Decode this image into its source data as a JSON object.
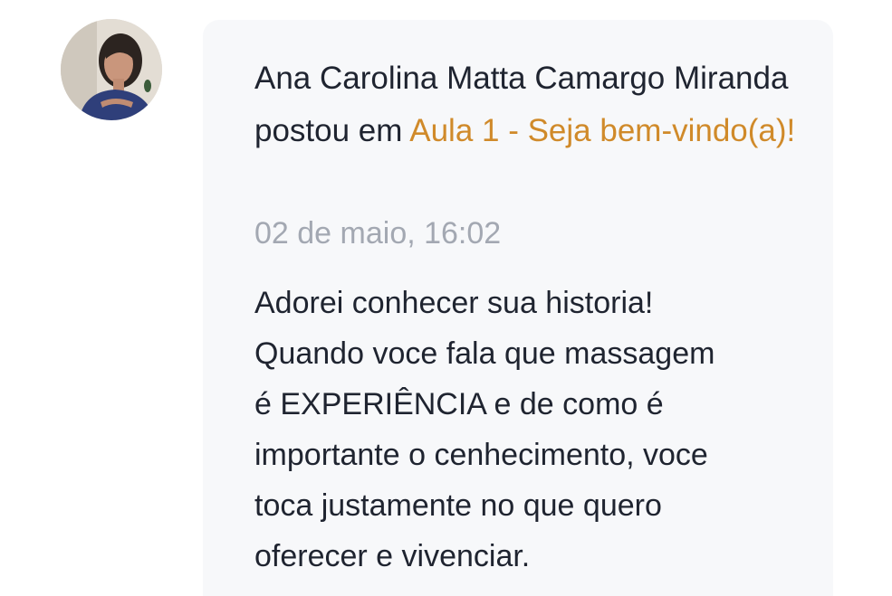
{
  "post": {
    "author": "Ana Carolina Matta Camargo Miranda",
    "action": " postou em ",
    "lesson_link": "Aula 1 - Seja bem-vindo(a)!",
    "timestamp": "02 de maio, 16:02",
    "body_lines": [
      "Adorei conhecer sua historia!",
      "Quando voce fala que massagem",
      "é EXPERIÊNCIA e de como é",
      "importante o cenhecimento, voce",
      "toca justamente no que quero",
      "oferecer e vivenciar."
    ]
  },
  "colors": {
    "link": "#d08a2a",
    "text": "#1f2430",
    "muted": "#a3a8b2",
    "card_bg": "#f7f8fa"
  },
  "icons": {
    "avatar": "user-avatar-photo"
  }
}
